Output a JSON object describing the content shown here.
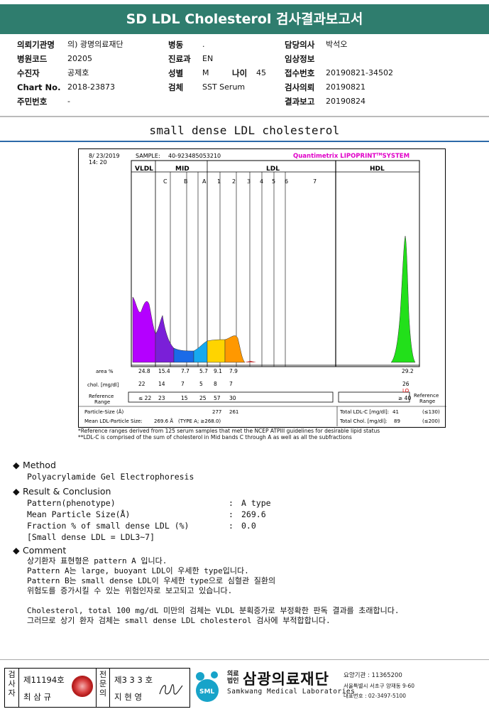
{
  "title": "SD LDL Cholesterol 검사결과보고서",
  "info": {
    "col1": [
      {
        "label": "의뢰기관명",
        "value": "의) 광명의료재단"
      },
      {
        "label": "병원코드",
        "value": "20205"
      },
      {
        "label": "수진자",
        "value": "공제호"
      },
      {
        "label": "Chart No.",
        "value": "2018-23873"
      },
      {
        "label": "주민번호",
        "value": "-"
      }
    ],
    "col2": [
      {
        "label": "병동",
        "value": "."
      },
      {
        "label": "진료과",
        "value": "EN"
      },
      {
        "label": "성별",
        "value": "M"
      },
      {
        "label": "검체",
        "value": "SST Serum"
      }
    ],
    "age": {
      "label": "나이",
      "value": "45"
    },
    "col3": [
      {
        "label": "담당의사",
        "value": "박석오"
      },
      {
        "label": "임상정보",
        "value": ""
      },
      {
        "label": "접수번호",
        "value": "20190821-34502"
      },
      {
        "label": "검사의뢰",
        "value": "20190821"
      },
      {
        "label": "결과보고",
        "value": "20190824"
      }
    ]
  },
  "subtitle": "small dense LDL cholesterol",
  "report": {
    "date": "8/ 23/2019",
    "time": "14: 20",
    "sample_label": "SAMPLE:",
    "sample_id": "40-923485053210",
    "brand": "Quantimetrix LIPOPRINT",
    "brand_tm": "TM",
    "brand_sys": "SYSTEM",
    "headers": {
      "vldl": "VLDL",
      "mid": "MID",
      "ldl": "LDL",
      "hdl": "HDL"
    },
    "mid_bands": [
      "C",
      "B",
      "A"
    ],
    "ldl_bands": [
      "1",
      "2",
      "3",
      "4",
      "5",
      "6",
      "7"
    ],
    "row_labels": {
      "area": "area %",
      "chol": "chol. [mg/dl]",
      "ref": "Reference Range"
    },
    "area_values": [
      "24.8",
      "15.4",
      "7.7",
      "5.7",
      "9.1",
      "7.9"
    ],
    "area_hdl": "29.2",
    "chol_values": [
      "22",
      "14",
      "7",
      "5",
      "8",
      "7"
    ],
    "chol_hdl": "26",
    "chol_hdl_flag": "LO",
    "ref_values": [
      "≤ 22",
      "23",
      "15",
      "25",
      "57",
      "30"
    ],
    "ref_hdl": "≥ 40",
    "ref_right_label": "Reference Range",
    "particle_size_label": "Particle-Size (Å)",
    "particle_sizes": [
      "277",
      "261"
    ],
    "mean_ldl_label": "Mean LDL-Particle Size:",
    "mean_ldl_value": "269.6 Å",
    "mean_ldl_type": "(TYPE A; ≥268.0)",
    "total_ldl_label": "Total LDL-C [mg/dl]:",
    "total_ldl_value": "41",
    "total_ldl_ref": "(≤130)",
    "total_chol_label": "Total Chol. [mg/dl]:",
    "total_chol_value": "89",
    "total_chol_ref": "(≤200)"
  },
  "notes": [
    "*Reference ranges derived from 125 serum samples that met the NCEP ATPIII guidelines for desirable lipid status",
    "**LDL-C is comprised of the sum of cholesterol in Mid bands C through A as well as all the subfractions"
  ],
  "method": {
    "heading": "Method",
    "text": "Polyacrylamide Gel Electrophoresis"
  },
  "result": {
    "heading": "Result & Conclusion",
    "rows": [
      {
        "k": "Pattern(phenotype)",
        "v": "A type"
      },
      {
        "k": "Mean Particle Size(Å)",
        "v": "269.6"
      },
      {
        "k": "Fraction % of small dense LDL (%)",
        "v": "0.0"
      }
    ],
    "bracket": "[Small dense LDL = LDL3~7]"
  },
  "comment": {
    "heading": "Comment",
    "lines": [
      "상기환자 표현형은 pattern A 입니다.",
      "Pattern A는 large, buoyant LDL이 우세한 type입니다.",
      "Pattern B는 small dense LDL이 우세한 type으로 심혈관 질환의",
      "위험도를 증가시킬 수 있는 위험인자로 보고되고 있습니다.",
      "",
      "Cholesterol, total 100 mg/dL 미만의 검체는 VLDL 분획증가로 부정확한 판독 결과를 초래합니다.",
      "그러므로 상기 환자 검체는 small dense LDL cholesterol 검사에 부적합합니다."
    ]
  },
  "footer": {
    "inspector_label": "검사자",
    "inspector_no": "제11194호",
    "inspector_name": "최 삼 규",
    "specialist_label": "전문의",
    "specialist_no": "제3 3 3 호",
    "specialist_name": "지 현 영",
    "corp_small": "의료 법인",
    "corp_name": "삼광의료재단",
    "corp_en": "Samkwang Medical Laboratories",
    "logo_text": "SML",
    "contact_code": "요양기관 : 11365200",
    "contact_addr": "서울특별시 서초구 양재동 9-60",
    "contact_tel": "대표번호 : 02-3497-5100"
  },
  "colors": {
    "title_bg": "#2f7d6e",
    "vldl": "#b400ff",
    "midC": "#7a1fd8",
    "midB": "#1a6be8",
    "midA": "#17a9f0",
    "ldl1": "#ffd400",
    "ldl2": "#ff9800",
    "hdl": "#22e01a",
    "brand_magenta": "#e000c8"
  }
}
